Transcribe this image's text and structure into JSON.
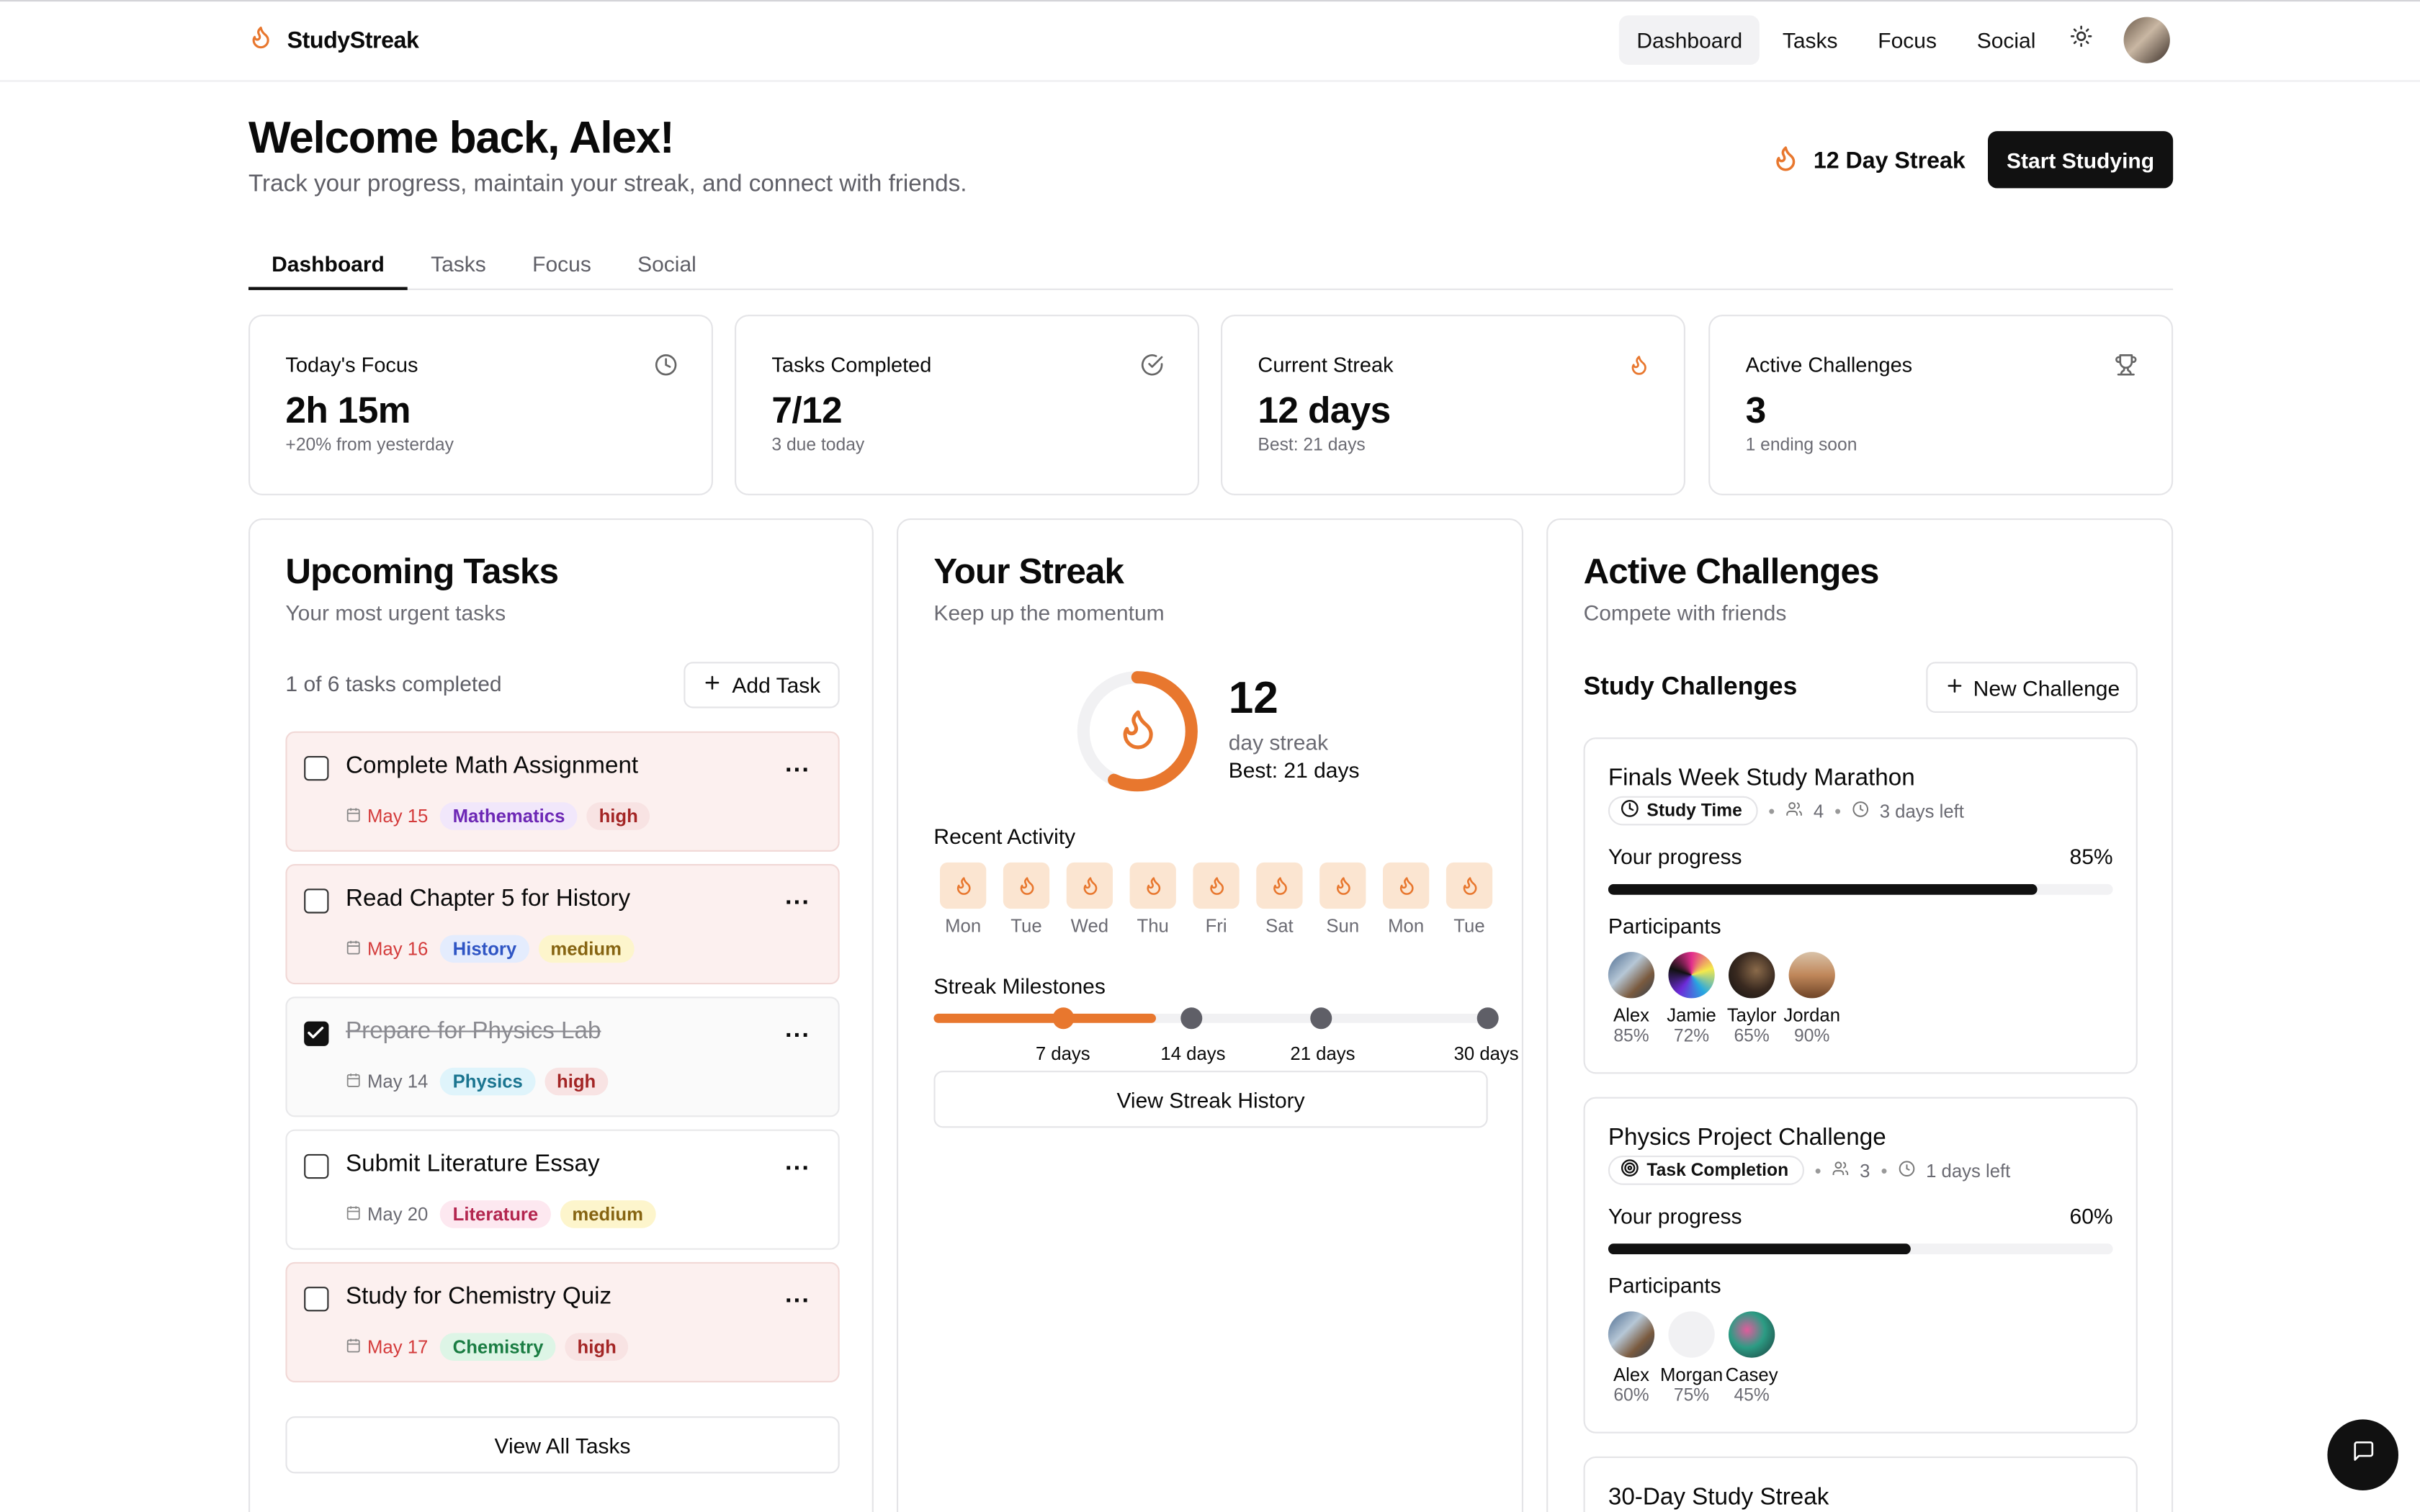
{
  "app": {
    "name": "StudyStreak"
  },
  "nav": {
    "items": [
      "Dashboard",
      "Tasks",
      "Focus",
      "Social"
    ],
    "active": "Dashboard"
  },
  "hero": {
    "title": "Welcome back, Alex!",
    "subtitle": "Track your progress, maintain your streak, and connect with friends.",
    "streak_label": "12 Day Streak",
    "start_button": "Start Studying"
  },
  "tabs": [
    "Dashboard",
    "Tasks",
    "Focus",
    "Social"
  ],
  "stats": [
    {
      "label": "Today's Focus",
      "value": "2h 15m",
      "hint": "+20% from yesterday",
      "icon": "clock-icon"
    },
    {
      "label": "Tasks Completed",
      "value": "7/12",
      "hint": "3 due today",
      "icon": "check-circle-icon"
    },
    {
      "label": "Current Streak",
      "value": "12 days",
      "hint": "Best: 21 days",
      "icon": "flame-icon"
    },
    {
      "label": "Active Challenges",
      "value": "3",
      "hint": "1 ending soon",
      "icon": "trophy-icon"
    }
  ],
  "upcoming": {
    "title": "Upcoming Tasks",
    "subtitle": "Your most urgent tasks",
    "count_text": "1 of 6 tasks completed",
    "add_button": "Add Task",
    "view_all": "View All Tasks",
    "more_label": "...",
    "tasks": [
      {
        "title": "Complete Math Assignment",
        "date": "May 15",
        "subject": "Mathematics",
        "priority": "high",
        "done": false,
        "overdue": true
      },
      {
        "title": "Read Chapter 5 for History",
        "date": "May 16",
        "subject": "History",
        "priority": "medium",
        "done": false,
        "overdue": true
      },
      {
        "title": "Prepare for Physics Lab",
        "date": "May 14",
        "subject": "Physics",
        "priority": "high",
        "done": true,
        "overdue": false
      },
      {
        "title": "Submit Literature Essay",
        "date": "May 20",
        "subject": "Literature",
        "priority": "medium",
        "done": false,
        "overdue": false
      },
      {
        "title": "Study for Chemistry Quiz",
        "date": "May 17",
        "subject": "Chemistry",
        "priority": "high",
        "done": false,
        "overdue": true
      }
    ]
  },
  "streak": {
    "title": "Your Streak",
    "subtitle": "Keep up the momentum",
    "count": "12",
    "count_label": "day streak",
    "best": "Best: 21 days",
    "ring_progress": 0.5714,
    "recent_label": "Recent Activity",
    "days": [
      "Mon",
      "Tue",
      "Wed",
      "Thu",
      "Fri",
      "Sat",
      "Sun",
      "Mon",
      "Tue"
    ],
    "milestones_label": "Streak Milestones",
    "milestones": [
      "7 days",
      "14 days",
      "21 days",
      "30 days"
    ],
    "milestone_progress": 0.4,
    "history_button": "View Streak History"
  },
  "challenges": {
    "title": "Active Challenges",
    "subtitle": "Compete with friends",
    "section_label": "Study Challenges",
    "new_button": "New Challenge",
    "progress_label": "Your progress",
    "participants_label": "Participants",
    "items": [
      {
        "title": "Finals Week Study Marathon",
        "type": "Study Time",
        "members": "4",
        "time_left": "3 days left",
        "progress": "85%",
        "progress_value": 0.85,
        "participants": [
          {
            "name": "Alex",
            "pct": "85%"
          },
          {
            "name": "Jamie",
            "pct": "72%"
          },
          {
            "name": "Taylor",
            "pct": "65%"
          },
          {
            "name": "Jordan",
            "pct": "90%"
          }
        ]
      },
      {
        "title": "Physics Project Challenge",
        "type": "Task Completion",
        "members": "3",
        "time_left": "1 days left",
        "progress": "60%",
        "progress_value": 0.6,
        "participants": [
          {
            "name": "Alex",
            "pct": "60%"
          },
          {
            "name": "Morgan",
            "pct": "75%"
          },
          {
            "name": "Casey",
            "pct": "45%"
          }
        ]
      },
      {
        "title": "30-Day Study Streak"
      }
    ]
  },
  "colors": {
    "accent": "#e8772e",
    "badges": {
      "Mathematics": [
        "#f1e7fb",
        "#6d28b5"
      ],
      "History": [
        "#e4ecfd",
        "#2f55c4"
      ],
      "Physics": [
        "#dff4fb",
        "#1b7590"
      ],
      "Literature": [
        "#fde8f0",
        "#b3264f"
      ],
      "Chemistry": [
        "#ddf5e6",
        "#1a7d43"
      ],
      "high": [
        "#f8e3e3",
        "#a32525"
      ],
      "medium": [
        "#fdf5cc",
        "#866412"
      ]
    }
  }
}
